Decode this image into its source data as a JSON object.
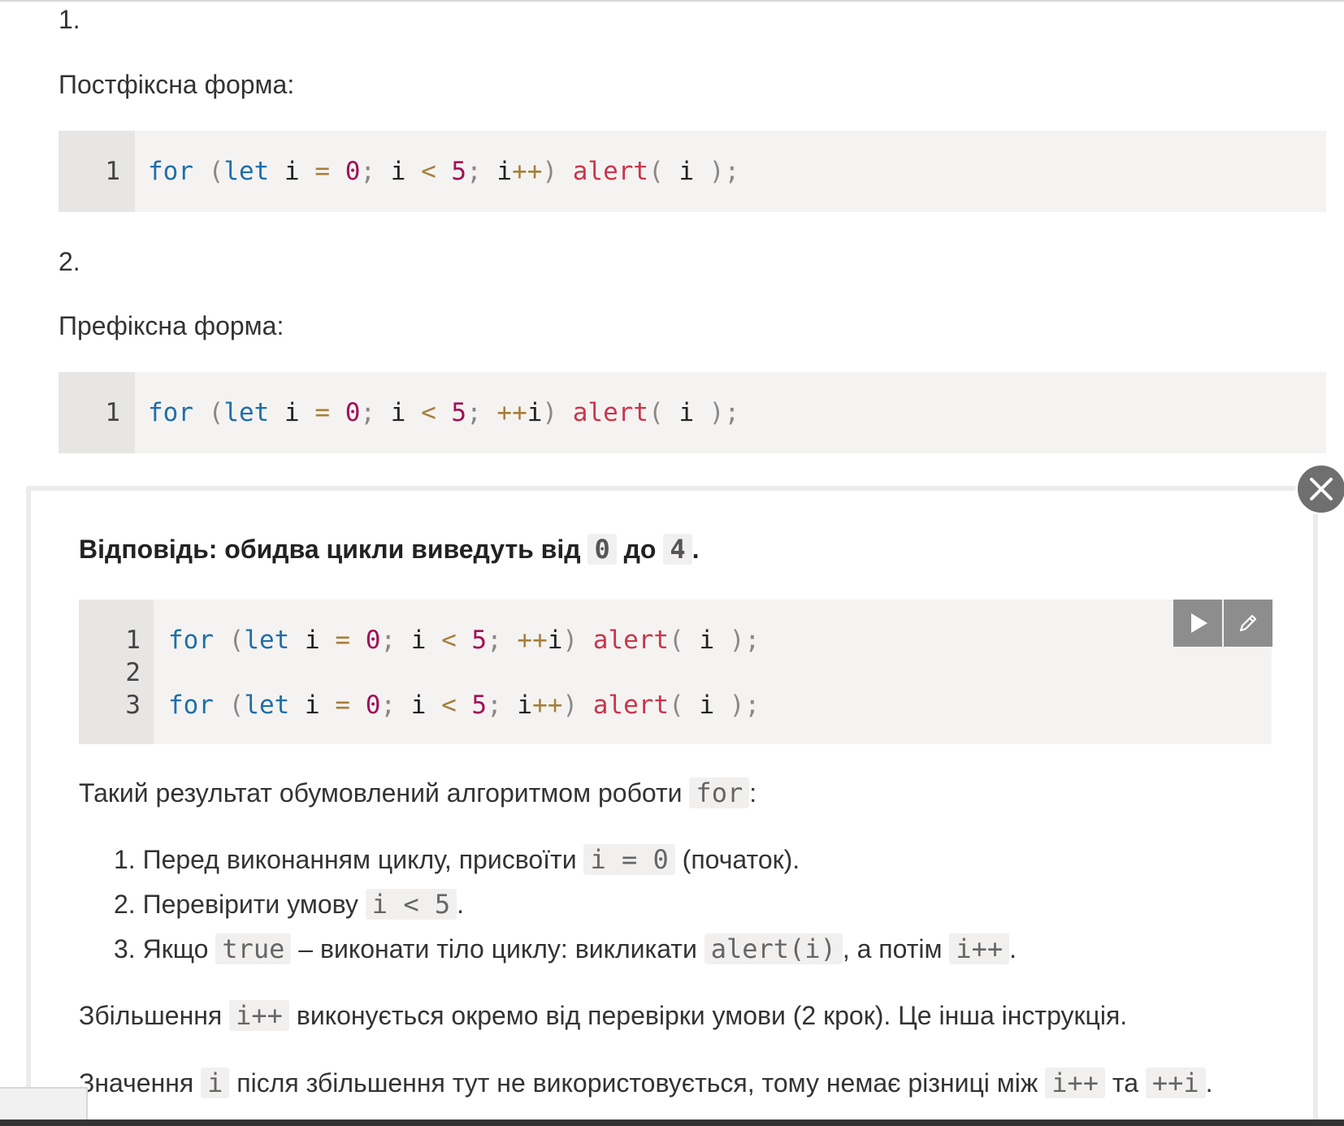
{
  "task": {
    "item1_number": "1.",
    "item1_label": "Постфіксна форма:",
    "item2_number": "2.",
    "item2_label": "Префіксна форма:",
    "code1": {
      "line_number": "1",
      "tokens": [
        "for",
        "(let",
        "i",
        "=",
        "0",
        ";",
        "i",
        "<",
        "5",
        ";",
        "i++",
        ")",
        "alert(",
        "i",
        ");"
      ]
    },
    "code2": {
      "line_number": "1",
      "tokens": [
        "for",
        "(let",
        "i",
        "=",
        "0",
        ";",
        "i",
        "<",
        "5",
        ";",
        "++i",
        ")",
        "alert(",
        "i",
        ");"
      ]
    }
  },
  "solution": {
    "answer_prefix": "Відповідь: обидва цикли виведуть від",
    "answer_from": "0",
    "answer_middle": "до",
    "answer_to": "4",
    "answer_end": ".",
    "code": {
      "line_numbers": [
        "1",
        "2",
        "3"
      ],
      "line1_increment": "++i",
      "line3_increment": "i++"
    },
    "run_button_icon": "play-icon",
    "edit_button_icon": "pencil-icon",
    "explanation_intro": "Такий результат обумовлений алгоритмом роботи",
    "explanation_intro_code": "for",
    "explanation_intro_end": ":",
    "steps": [
      {
        "num": "1.",
        "text_a": "Перед виконанням циклу, присвоїти",
        "code": "i = 0",
        "text_b": "(початок)."
      },
      {
        "num": "2.",
        "text_a": "Перевірити умову",
        "code": "i < 5",
        "text_b": "."
      },
      {
        "num": "3.",
        "text_a": "Якщо",
        "code": "true",
        "text_b": "– виконати тіло циклу: викликати",
        "code2": "alert(i)",
        "text_c": ", а потім",
        "code3": "i++",
        "text_d": "."
      }
    ],
    "para2_a": "Збільшення",
    "para2_code": "i++",
    "para2_b": "виконується окремо від перевірки умови (2 крок). Це інша інструкція.",
    "para3_a": "Значення",
    "para3_code": "i",
    "para3_b": "після збільшення тут не використовується, тому немає різниці між",
    "para3_code2": "i++",
    "para3_c": "та",
    "para3_code3": "++i",
    "para3_d": "."
  },
  "close_button_icon": "close-icon"
}
